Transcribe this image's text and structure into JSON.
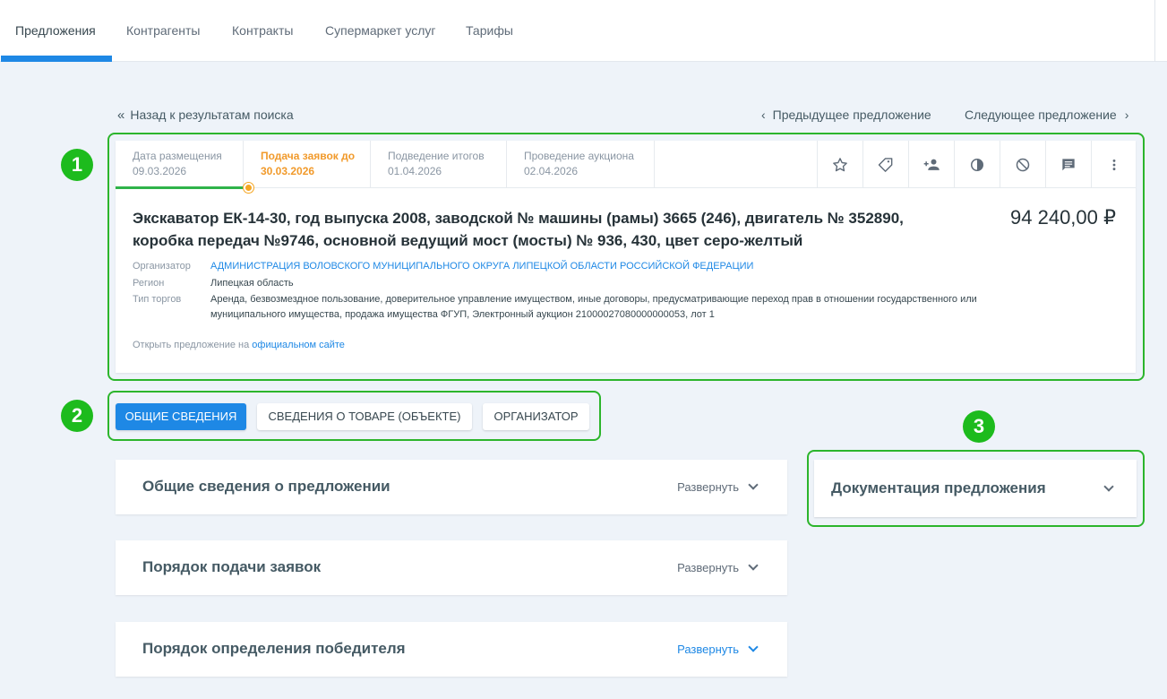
{
  "nav": {
    "tabs": [
      {
        "label": "Предложения",
        "active": true
      },
      {
        "label": "Контрагенты"
      },
      {
        "label": "Контракты"
      },
      {
        "label": "Супермаркет услуг"
      },
      {
        "label": "Тарифы"
      }
    ]
  },
  "links": {
    "back": "Назад к результатам поиска",
    "prev": "Предыдущее предложение",
    "next": "Следующее предложение"
  },
  "badges": [
    "1",
    "2",
    "3"
  ],
  "dates": [
    {
      "label": "Дата размещения",
      "value": "09.03.2026"
    },
    {
      "label": "Подача заявок до",
      "value": "30.03.2026",
      "active": true
    },
    {
      "label": "Подведение итогов",
      "value": "01.04.2026"
    },
    {
      "label": "Проведение аукциона",
      "value": "02.04.2026"
    }
  ],
  "actions": [
    "star-icon",
    "tag-icon",
    "add-person-icon",
    "contrast-icon",
    "block-icon",
    "comment-icon",
    "more-vertical-icon"
  ],
  "offer": {
    "title": "Экскаватор ЕК-14-30, год выпуска 2008, заводской № машины (рамы) 3665 (246), двигатель № 352890, коробка передач №9746, основной ведущий мост (мосты) № 936, 430, цвет серо-желтый",
    "price": "94 240,00 ₽",
    "organizer_label": "Организатор",
    "organizer": "АДМИНИСТРАЦИЯ ВОЛОВСКОГО МУНИЦИПАЛЬНОГО ОКРУГА ЛИПЕЦКОЙ ОБЛАСТИ РОССИЙСКОЙ ФЕДЕРАЦИИ",
    "region_label": "Регион",
    "region": "Липецкая область",
    "type_label": "Тип торгов",
    "type": "Аренда, безвозмездное пользование, доверительное управление имуществом, иные договоры, предусматривающие переход прав в отношении государственного или муниципального имущества, продажа имущества ФГУП, Электронный аукцион 21000027080000000053, лот 1",
    "open_prefix": "Открыть предложение на",
    "open_link": "официальном сайте"
  },
  "section_tabs": [
    {
      "label": "ОБЩИЕ СВЕДЕНИЯ",
      "active": true
    },
    {
      "label": "СВЕДЕНИЯ О ТОВАРЕ (ОБЪЕКТЕ)"
    },
    {
      "label": "ОРГАНИЗАТОР"
    }
  ],
  "sections": [
    {
      "title": "Общие сведения о предложении",
      "expand": "Развернуть"
    },
    {
      "title": "Порядок подачи заявок",
      "expand": "Развернуть"
    },
    {
      "title": "Порядок определения победителя",
      "expand": "Развернуть"
    }
  ],
  "documents": {
    "title": "Документация предложения"
  },
  "colors": {
    "accent": "#1e88e5",
    "highlight": "#2cb52c",
    "deadline": "#f19a2b",
    "progress": "#2fb34a"
  }
}
